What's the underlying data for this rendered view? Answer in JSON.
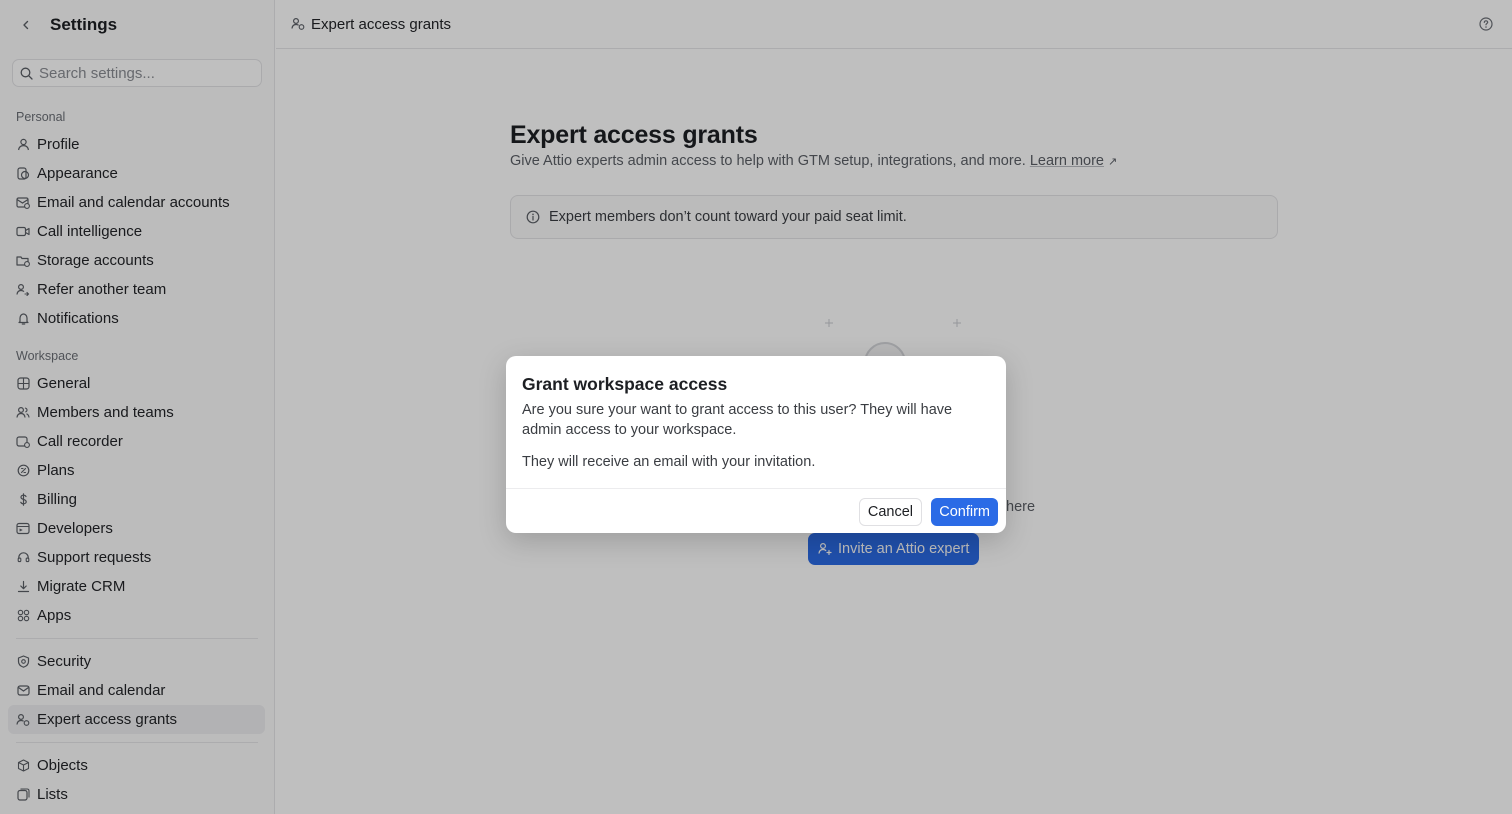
{
  "sidebar": {
    "title": "Settings",
    "search_placeholder": "Search settings...",
    "personal_label": "Personal",
    "personal_items": [
      {
        "label": "Profile",
        "icon": "user-icon"
      },
      {
        "label": "Appearance",
        "icon": "appearance-icon"
      },
      {
        "label": "Email and calendar accounts",
        "icon": "email-calendar-accounts-icon"
      },
      {
        "label": "Call intelligence",
        "icon": "video-icon"
      },
      {
        "label": "Storage accounts",
        "icon": "storage-icon"
      },
      {
        "label": "Refer another team",
        "icon": "refer-icon"
      },
      {
        "label": "Notifications",
        "icon": "bell-icon"
      }
    ],
    "workspace_label": "Workspace",
    "workspace_items": [
      {
        "label": "General",
        "icon": "general-icon"
      },
      {
        "label": "Members and teams",
        "icon": "members-icon"
      },
      {
        "label": "Call recorder",
        "icon": "recorder-icon"
      },
      {
        "label": "Plans",
        "icon": "plans-icon"
      },
      {
        "label": "Billing",
        "icon": "dollar-icon"
      },
      {
        "label": "Developers",
        "icon": "developers-icon"
      },
      {
        "label": "Support requests",
        "icon": "headset-icon"
      },
      {
        "label": "Migrate CRM",
        "icon": "download-icon"
      },
      {
        "label": "Apps",
        "icon": "apps-icon"
      }
    ],
    "security_items": [
      {
        "label": "Security",
        "icon": "shield-icon"
      },
      {
        "label": "Email and calendar",
        "icon": "mail-icon"
      },
      {
        "label": "Expert access grants",
        "icon": "expert-icon",
        "active": true
      }
    ],
    "data_items": [
      {
        "label": "Objects",
        "icon": "cube-icon"
      },
      {
        "label": "Lists",
        "icon": "lists-icon"
      }
    ]
  },
  "topbar": {
    "breadcrumb": "Expert access grants"
  },
  "main": {
    "title": "Expert access grants",
    "description": "Give Attio experts admin access to help with GTM setup, integrations, and more.",
    "learn_more": "Learn more",
    "learn_more_arrow": "↗",
    "info": "Expert members don’t count toward your paid seat limit.",
    "empty_text_partial": "here",
    "invite_button": "Invite an Attio expert"
  },
  "modal": {
    "title": "Grant workspace access",
    "body_1": "Are you sure your want to grant access to this user? They will have admin access to your workspace.",
    "body_2": "They will receive an email with your invitation.",
    "cancel": "Cancel",
    "confirm": "Confirm"
  },
  "colors": {
    "accent": "#2b6be6",
    "overlay": "rgba(0,0,0,0.25)"
  }
}
